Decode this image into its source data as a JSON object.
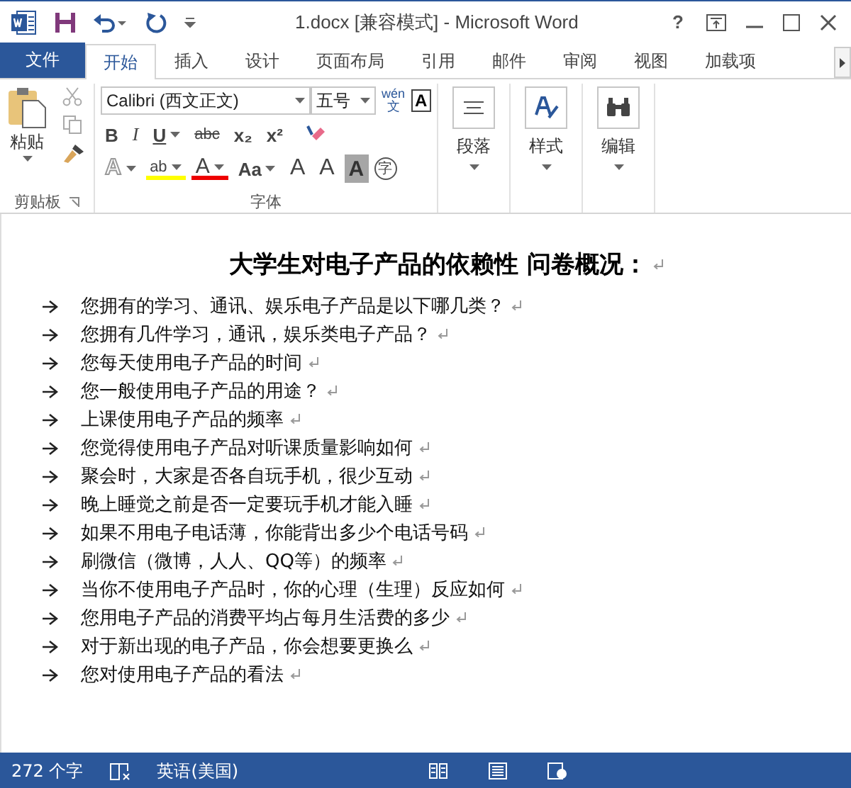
{
  "window": {
    "title": "1.docx [兼容模式] - Microsoft Word",
    "help": "?"
  },
  "file_tab": {
    "label": "文件"
  },
  "tabs": [
    {
      "label": "开始",
      "selected": true
    },
    {
      "label": "插入",
      "selected": false
    },
    {
      "label": "设计",
      "selected": false
    },
    {
      "label": "页面布局",
      "selected": false
    },
    {
      "label": "引用",
      "selected": false
    },
    {
      "label": "邮件",
      "selected": false
    },
    {
      "label": "审阅",
      "selected": false
    },
    {
      "label": "视图",
      "selected": false
    },
    {
      "label": "加载项",
      "selected": false
    }
  ],
  "ribbon": {
    "paste_label": "粘贴",
    "clipboard_group": "剪贴板",
    "font_group": "字体",
    "font_name": "Calibri (西文正文)",
    "font_size": "五号",
    "phonetic": "wén",
    "phonetic_base": "文",
    "border_char": "A",
    "format_buttons": [
      {
        "label": "B",
        "kind": "bold",
        "dropdown": false
      },
      {
        "label": "I",
        "kind": "italic",
        "dropdown": false
      },
      {
        "label": "U",
        "kind": "underline",
        "dropdown": true
      },
      {
        "label": "abc",
        "kind": "strike",
        "dropdown": false
      },
      {
        "label": "x₂",
        "kind": "plain",
        "dropdown": false
      },
      {
        "label": "x²",
        "kind": "plain",
        "dropdown": false
      }
    ],
    "effect_buttons": [
      {
        "label": "A",
        "kind": "outline",
        "dropdown": true
      },
      {
        "label": "ab",
        "kind": "highlight",
        "dropdown": true
      },
      {
        "label": "A",
        "kind": "color",
        "dropdown": true
      },
      {
        "label": "Aa",
        "kind": "plain",
        "dropdown": true
      },
      {
        "label": "A",
        "kind": "grow",
        "dropdown": false
      },
      {
        "label": "A",
        "kind": "shrink",
        "dropdown": false
      },
      {
        "label": "A",
        "kind": "shade",
        "dropdown": false
      },
      {
        "label": "字",
        "kind": "circle",
        "dropdown": false
      }
    ],
    "big_buttons": [
      {
        "label": "段落",
        "kind": "paragraph"
      },
      {
        "label": "样式",
        "kind": "styles"
      },
      {
        "label": "编辑",
        "kind": "editing"
      }
    ]
  },
  "document": {
    "title": "大学生对电子产品的依赖性 问卷概况：",
    "items": [
      "您拥有的学习、通讯、娱乐电子产品是以下哪几类？",
      "您拥有几件学习，通讯，娱乐类电子产品？",
      "您每天使用电子产品的时间",
      "您一般使用电子产品的用途？",
      "上课使用电子产品的频率",
      "您觉得使用电子产品对听课质量影响如何",
      "聚会时，大家是否各自玩手机，很少互动",
      "晚上睡觉之前是否一定要玩手机才能入睡",
      "如果不用电子电话薄，你能背出多少个电话号码",
      "刷微信（微博，人人、QQ等）的频率",
      "当你不使用电子产品时，你的心理（生理）反应如何",
      "您用电子产品的消费平均占每月生活费的多少",
      "对于新出现的电子产品，你会想要更换么",
      "您对使用电子产品的看法"
    ]
  },
  "status_bar": {
    "word_count": "272 个字",
    "language": "英语(美国)"
  }
}
